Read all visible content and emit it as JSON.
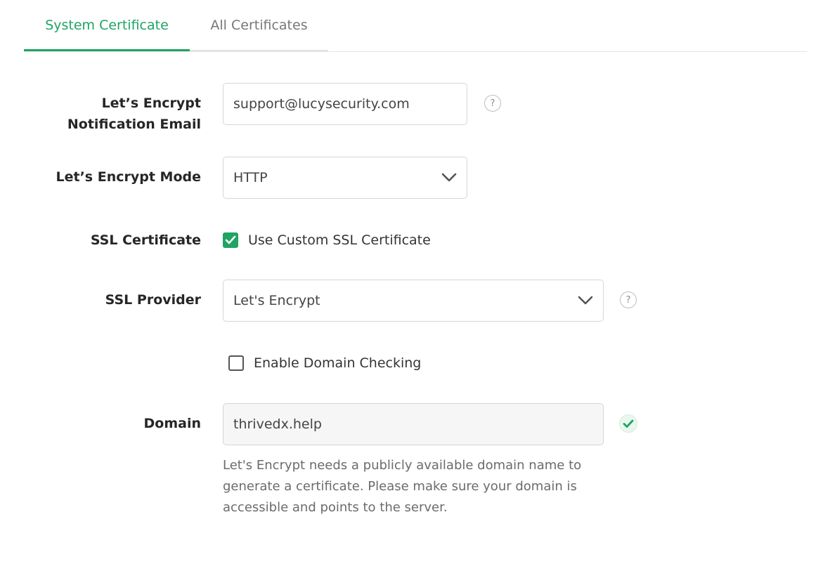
{
  "tabs": [
    {
      "label": "System Certificate",
      "active": true
    },
    {
      "label": "All Certificates",
      "active": false
    }
  ],
  "form": {
    "notification_email": {
      "label_line1": "Let’s Encrypt",
      "label_line2": "Notification Email",
      "value": "support@lucysecurity.com",
      "help_icon": "question-circle"
    },
    "mode": {
      "label": "Let’s Encrypt Mode",
      "value": "HTTP",
      "icon": "chevron-down"
    },
    "ssl_certificate": {
      "label": "SSL Certificate",
      "checkbox_label": "Use Custom SSL Certificate",
      "checked": true
    },
    "ssl_provider": {
      "label": "SSL Provider",
      "value": "Let's Encrypt",
      "icon": "chevron-down",
      "help_icon": "question-circle"
    },
    "domain_checking": {
      "checkbox_label": "Enable Domain Checking",
      "checked": false
    },
    "domain": {
      "label": "Domain",
      "value": "thrivedx.help",
      "status_icon": "check-circle"
    },
    "note": "Let's Encrypt needs a publicly available domain name to generate a certificate. Please make sure your domain is accessible and points to the server."
  },
  "colors": {
    "accent": "#1fa463",
    "inactive_tab": "#777777",
    "border": "#d6d6d6"
  }
}
